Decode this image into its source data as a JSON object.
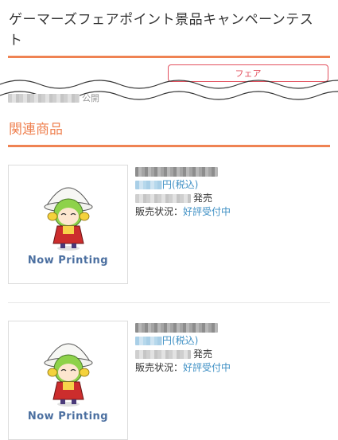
{
  "page": {
    "title": "ゲーマーズフェアポイント景品キャンペーンテスト",
    "tag_button_label": "フェア",
    "published_label": "公開",
    "accent_color": "#ef8353",
    "tag_color": "#e2505e",
    "link_color": "#3d8fc4"
  },
  "related": {
    "heading": "関連商品",
    "products": [
      {
        "image_caption": "Now Printing",
        "price_suffix": "円(税込)",
        "release_suffix": "発売",
        "status_label": "販売状況：",
        "status_value": "好評受付中"
      },
      {
        "image_caption": "Now Printing",
        "price_suffix": "円(税込)",
        "release_suffix": "発売",
        "status_label": "販売状況：",
        "status_value": "好評受付中"
      }
    ]
  }
}
